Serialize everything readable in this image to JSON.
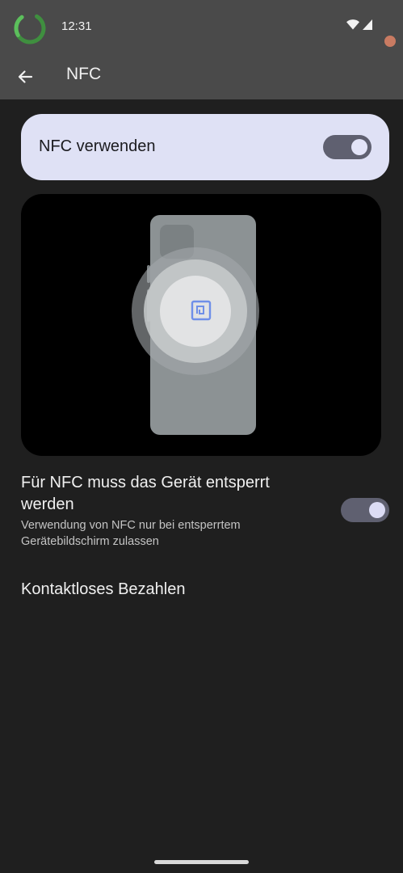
{
  "status_bar": {
    "time": "12:31",
    "icons": [
      "wifi-icon",
      "cell-signal-icon"
    ],
    "ring_color": "#4caf50"
  },
  "app_bar": {
    "back_icon": "arrow-back-icon",
    "title": "NFC"
  },
  "main_toggle": {
    "label": "NFC verwenden",
    "enabled": true
  },
  "illustration": {
    "description_icon": "nfc-phone-illustration",
    "accent_color": "#6f8fe8"
  },
  "lock_setting": {
    "title": "Für NFC muss das Gerät entsperrt werden",
    "subtitle": "Verwendung von NFC nur bei entsperrtem Gerätebildschirm zulassen",
    "enabled": true
  },
  "payment": {
    "label": "Kontaktloses Bezahlen"
  },
  "colors": {
    "header_bg": "#4a4a4a",
    "page_bg": "#1f1f1f",
    "card_bg": "#dfe1f5",
    "switch_track": "#5f6070"
  }
}
